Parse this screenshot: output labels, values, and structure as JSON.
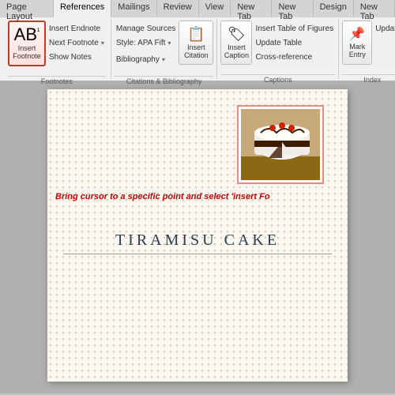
{
  "ribbon": {
    "tabs": [
      {
        "label": "Page Layout"
      },
      {
        "label": "References",
        "active": true
      },
      {
        "label": "Mailings"
      },
      {
        "label": "Review"
      },
      {
        "label": "View"
      },
      {
        "label": "New Tab"
      },
      {
        "label": "New Tab"
      },
      {
        "label": "Design"
      },
      {
        "label": "New Tab"
      }
    ],
    "groups": {
      "footnotes": {
        "label": "Footnotes",
        "insert_footnote": {
          "label": "Insert\nFootnote",
          "icon": "AB"
        },
        "buttons": [
          {
            "label": "Insert Endnote"
          },
          {
            "label": "Next Footnote",
            "has_dropdown": true
          },
          {
            "label": "Show Notes"
          }
        ]
      },
      "citations": {
        "label": "Citations & Bibliography",
        "manage_sources": {
          "label": "Manage Sources"
        },
        "style": {
          "label": "Style: APA Fift",
          "has_dropdown": true
        },
        "insert_citation": {
          "label": "Insert\nCitation",
          "icon": "📝"
        },
        "bibliography": {
          "label": "Bibliography",
          "has_dropdown": true
        }
      },
      "captions": {
        "label": "Captions",
        "insert_caption_label": "Insert\nCaption",
        "buttons": [
          {
            "label": "Insert Table of Figures"
          },
          {
            "label": "Update Table"
          },
          {
            "label": "Cross-reference"
          }
        ]
      },
      "index": {
        "label": "Index",
        "mark_entry_label": "Mark\nEntry",
        "buttons": [
          {
            "label": "Update"
          }
        ]
      }
    }
  },
  "document": {
    "instruction": "Bring cursor to a specific point and select 'insert Fo",
    "title": "TIRAMISU CAKE",
    "image_alt": "Tiramisu cake photo"
  }
}
